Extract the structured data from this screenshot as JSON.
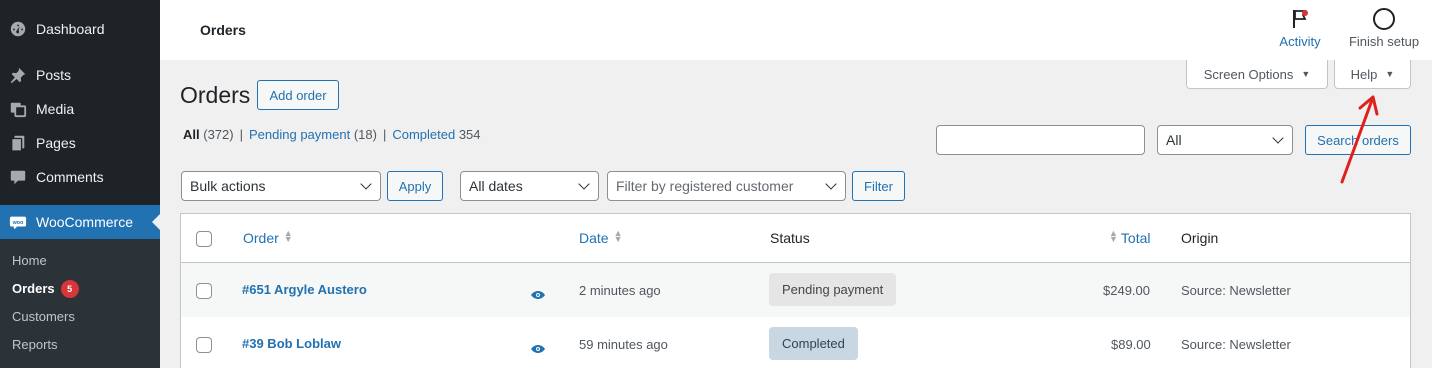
{
  "sidebar": {
    "items": [
      {
        "label": "Dashboard",
        "icon": "dashboard-icon"
      },
      {
        "label": "Posts",
        "icon": "pin-icon"
      },
      {
        "label": "Media",
        "icon": "media-icon"
      },
      {
        "label": "Pages",
        "icon": "pages-icon"
      },
      {
        "label": "Comments",
        "icon": "comment-icon"
      },
      {
        "label": "WooCommerce",
        "icon": "woo-icon",
        "active": true
      }
    ],
    "submenu": [
      {
        "label": "Home"
      },
      {
        "label": "Orders",
        "badge": "5",
        "current": true
      },
      {
        "label": "Customers"
      },
      {
        "label": "Reports"
      }
    ]
  },
  "header": {
    "title": "Orders",
    "activity_label": "Activity",
    "finish_setup_label": "Finish setup"
  },
  "tabs": {
    "screen_options": "Screen Options",
    "help": "Help"
  },
  "page": {
    "title": "Orders",
    "add_order": "Add order"
  },
  "filters_views": {
    "all_label": "All",
    "all_count": "(372)",
    "pending_label": "Pending payment",
    "pending_count": "(18)",
    "completed_label": "Completed",
    "completed_count": "354"
  },
  "search": {
    "value": "",
    "scope_select": "All",
    "button": "Search orders"
  },
  "bulk": {
    "select": "Bulk actions",
    "apply": "Apply",
    "dates": "All dates",
    "customer_placeholder": "Filter by registered customer",
    "filter": "Filter"
  },
  "table": {
    "columns": {
      "order": "Order",
      "date": "Date",
      "status": "Status",
      "total": "Total",
      "origin": "Origin"
    },
    "rows": [
      {
        "order": "#651 Argyle Austero",
        "date": "2 minutes ago",
        "status": "Pending payment",
        "total": "$249.00",
        "origin": "Source: Newsletter"
      },
      {
        "order": "#39 Bob Loblaw",
        "date": "59 minutes ago",
        "status": "Completed",
        "total": "$89.00",
        "origin": "Source: Newsletter"
      }
    ]
  },
  "colors": {
    "accent": "#2271b1",
    "sidebar": "#1d2327",
    "badge": "#d63638",
    "annotation": "#e0201b"
  }
}
